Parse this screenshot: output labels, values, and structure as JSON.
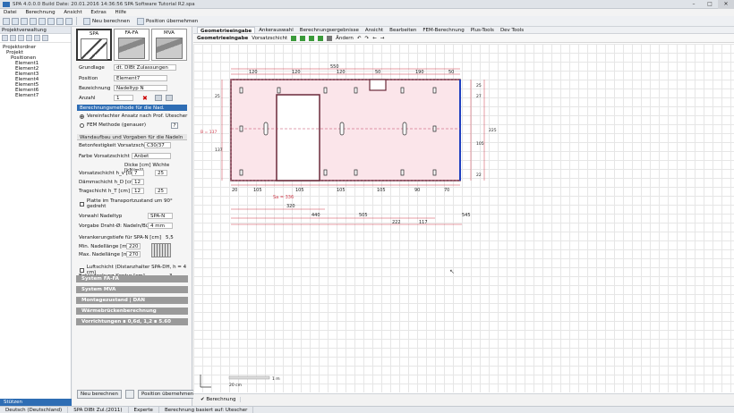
{
  "title": "SPA 4.0.0.0    Build Date: 20.01.2016 14:36:56    SPA Software Tutorial R2.spa",
  "menu": [
    "Datei",
    "Berechnung",
    "Ansicht",
    "Extras",
    "Hilfe"
  ],
  "toolbar": {
    "new_calc": "Neu berechnen",
    "apply_pos": "Position übernehmen"
  },
  "left": {
    "header": "Projektverwaltung",
    "tree": [
      "Projektordner",
      "Projekt",
      "Positionen",
      "Element1",
      "Element2",
      "Element3",
      "Element4",
      "Element5",
      "Element6",
      "Element7"
    ],
    "footer": "Stützen"
  },
  "mid": {
    "systems": [
      "SPA",
      "FA-FA",
      "MVA"
    ],
    "grundlage_label": "Grundlage",
    "grundlage_val": "dt. DIBt Zulassungen",
    "position_label": "Position",
    "position_val": "Element7",
    "bez_label": "Bezeichnung",
    "bez_val": "Nadeltyp N",
    "anzahl_label": "Anzahl",
    "anzahl_val": "1",
    "method_hdr": "Berechnungsmethode für die Nad. Einwirkungen",
    "radio1": "Vereinfachter Ansatz nach Prof. Utescher",
    "radio2": "FEM Methode (genauer)",
    "wand_hdr": "Wandaufbau und Vorgaben für die Nadeln",
    "beton_label": "Betonfestigkeit Vorsatzschicht",
    "beton_val": "C30/37",
    "farbe_label": "Farbe Vorsatzschicht",
    "farbe_val": "Anbet",
    "dicke_hdr": "Dicke [cm]  Wichte [kN/m³]",
    "vs_label": "Vorsatzschicht h_v [cm]",
    "vs_d": "7",
    "vs_w": "25",
    "dd_label": "Dämmschicht h_D [cm]",
    "dd_d": "12",
    "ts_label": "Tragschicht h_T [cm]",
    "ts_d": "12",
    "ts_w": "25",
    "platte_chk": "Platte im Transportzustand um 90° gedreht",
    "vorwahl_label": "Vorwahl Nadeltyp",
    "vorwahl_val": "SPA-N",
    "vorgabe_label": "Vorgabe Draht-Ø: Nadeln/Bügel",
    "vorgabe_val": "4 mm",
    "verank_label": "Verankerungstiefe für SPA-N [cm]",
    "verank_val": "5,5",
    "min_label": "Min. Nadellänge [mm]",
    "min_val": "220",
    "max_label": "Max. Nadellänge [mm]",
    "max_val": "270",
    "luft_chk": "Luftschicht (Distanzhalter SPA-DH, h = 4 cm)",
    "betonde_label": "Betondeckung Kontur [cm]",
    "betonde_val": "3",
    "gray_sections": [
      "System FA-FA",
      "System MVA",
      "Montagezustand  |  DAN",
      "Wärmebrückenberechnung",
      "Vorrichtungen  ∎ 0,6d, 1,2  ∎ 5.60"
    ],
    "btn_new": "Neu berechnen",
    "btn_apply": "Position übernehmen"
  },
  "right": {
    "tabs": [
      "Geometrieeingabe",
      "Ankerauswahl",
      "Berechnungsergebnisse",
      "Ansicht",
      "Bearbeiten",
      "FEM-Berechnung",
      "Plus-Tools",
      "Dev Tools"
    ],
    "subtabs": [
      "Geometrieeingabe",
      "Vorsatzschicht"
    ],
    "subtool_change": "Ändern",
    "dims_top_total": "550",
    "dims_top": [
      "120",
      "120",
      "120",
      "50",
      "190"
    ],
    "dims_top_right": "50",
    "dims_bottom": [
      "20",
      "105",
      "105",
      "105",
      "105",
      "90",
      "70"
    ],
    "sa_label": "Sa = 336",
    "dim_320": "320",
    "dim_440": "440",
    "dim_505": "505",
    "dim_545": "545",
    "dim_222": "222",
    "dim_117": "117",
    "dims_right": [
      "25",
      "27",
      "105",
      "22",
      "225"
    ],
    "dims_left": [
      "25",
      "B = 137",
      "137"
    ],
    "scale_1m": "1 m",
    "scale_20cm": "20 cm",
    "calc_btn": "Berechnung"
  },
  "status": [
    "Deutsch (Deutschland)",
    "SPA DIBt Zul.(2011)",
    "Experte",
    "Berechnung basiert auf: Utescher"
  ]
}
